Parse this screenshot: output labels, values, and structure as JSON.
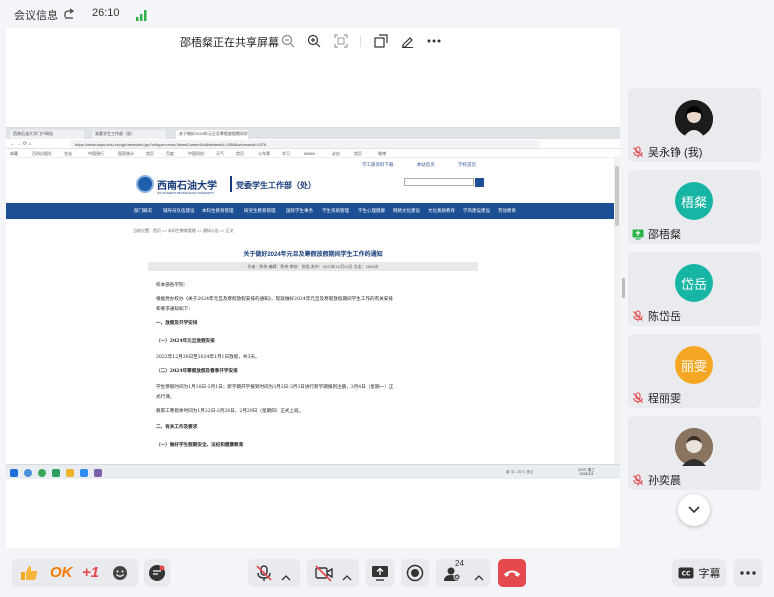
{
  "top_bar": {
    "meeting_info_label": "会议信息",
    "timer": "26:10"
  },
  "share_bar": {
    "title": "邵梧粲正在共享屏幕"
  },
  "shared_screen": {
    "tabs": [
      "西南石油大学门户网站",
      "党委学生工作部（处）",
      "关于做好2024年元旦及寒假放假期间学生工作的通知"
    ],
    "url": "https://www.swpu.edu.cn/xgb/newsinfo.jsp?urltype=news.NewsContentUrl&wbtreeid=1386&wbnewsid=1976",
    "bookmarks": [
      "收藏",
      "百科出版社",
      "名站",
      "中国银行",
      "国家统计",
      "首页",
      "百度",
      "中国科协",
      "天气",
      "首页",
      "火车票",
      "学习",
      "BiliBili",
      "必应",
      "首页",
      "微博"
    ],
    "util_links": [
      "学工部资料下载",
      "本站首页",
      "学校首页"
    ],
    "school_name": "西南石油大学",
    "school_name_en": "SOUTHWEST PETROLEUM UNIVERSITY",
    "department": "党委学生工作部（处）",
    "nav": [
      "部门概况",
      "辅导员队伍建设",
      "本科生教育管理",
      "研究生教育管理",
      "国际学生事务",
      "学生资助管理",
      "学生心理健康",
      "网络文化建设",
      "文化素质教育",
      "学风建设建设",
      "劳动教育"
    ],
    "breadcrumb": "当前位置：首页 >> 本科生教育管理 >> 通知公告 >> 正文",
    "article_title": "关于做好2024年元旦及寒假放假期间学生工作的通知",
    "article_meta": "作者：陈伟  编辑：陈伟  审核：张强  发布：2023年12月26日  点击：2836次",
    "article_lines": [
      "校本部各学院：",
      "    根据党办校办《关于2024年元旦及寒假放假安排的通知》，现就做好2024年元旦及寒假放假期间学生工作的有关安排",
      "和要求通知如下：",
      "    一、放假及开学安排",
      "    （一）2024年元旦放假安排",
      "    2023年12月30日至2024年1月1日放假，共3天。",
      "    （二）2024年寒假放假及春季开学安排",
      "    学生寒假时间为1月18日-3月1日；新学期开学报到时间为3月2日-3月3日进行新学期报到注册，3月4日（星期一）正",
      "式行课。",
      "    教职工寒假休时间为1月22日-2月28日，2月29日（星期四）正式上班。",
      "    二、有关工作及要求",
      "    （一）做好学生假期安全、法纪和健康教育"
    ],
    "taskbar_tray": "英 中 ♪ 20°C 多云",
    "taskbar_clock": "22:07 周三\n2024/1/3"
  },
  "participants": [
    {
      "name": "吴永铮 (我)",
      "avatar_text": "",
      "avatar_color": "#2b2b2b",
      "muted": true
    },
    {
      "name": "邵梧粲",
      "avatar_text": "梧粲",
      "avatar_color": "#17b5a3",
      "sharing": true
    },
    {
      "name": "陈岱岳",
      "avatar_text": "岱岳",
      "avatar_color": "#17b5a3",
      "muted": true
    },
    {
      "name": "程丽雯",
      "avatar_text": "丽雯",
      "avatar_color": "#f5a623",
      "muted": true
    },
    {
      "name": "孙奕晨",
      "avatar_text": "",
      "avatar_color": "#6b5b4a",
      "muted": true
    }
  ],
  "bottom_bar": {
    "reaction_ok": "OK",
    "reaction_plus": "+1",
    "participants_count": "24",
    "subtitle_label": "字幕"
  },
  "colors": {
    "accent_red": "#e5484d",
    "teal": "#17b5a3",
    "signal_green": "#2bb34a"
  }
}
